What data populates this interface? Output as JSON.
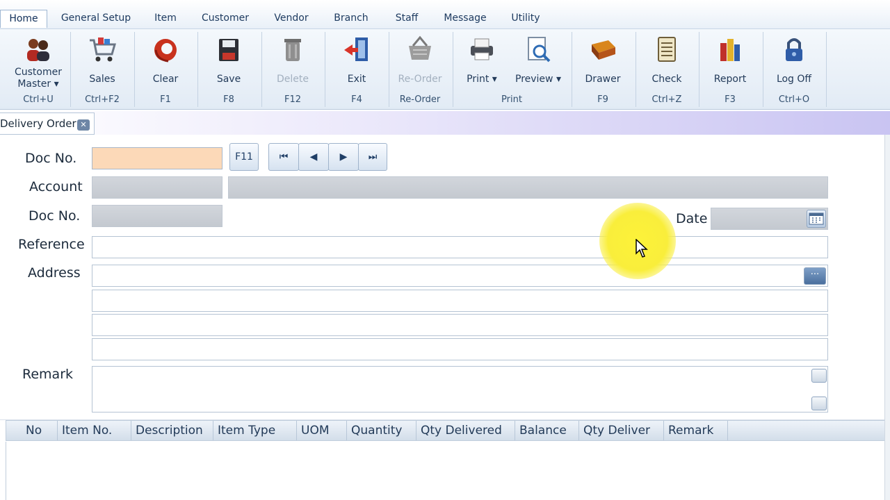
{
  "menu": {
    "tabs": [
      "Home",
      "General Setup",
      "Item",
      "Customer",
      "Vendor",
      "Branch",
      "Staff",
      "Message",
      "Utility"
    ]
  },
  "ribbon": {
    "buttons": [
      {
        "label_line1": "Customer",
        "label_line2": "Master ▾",
        "shortcut": "Ctrl+U",
        "icon": "customers-icon",
        "enabled": true
      },
      {
        "label": "Sales",
        "shortcut": "Ctrl+F2",
        "icon": "shopping-cart-icon",
        "enabled": true
      },
      {
        "label": "Clear",
        "shortcut": "F1",
        "icon": "clear-icon",
        "enabled": true
      },
      {
        "label": "Save",
        "shortcut": "F8",
        "icon": "floppy-disk-icon",
        "enabled": true
      },
      {
        "label": "Delete",
        "shortcut": "F12",
        "icon": "trash-can-icon",
        "enabled": false
      },
      {
        "label": "Exit",
        "shortcut": "F4",
        "icon": "exit-door-icon",
        "enabled": true
      },
      {
        "label": "Re-Order",
        "shortcut": "Re-Order",
        "icon": "basket-icon",
        "enabled": false
      },
      {
        "label": "Print ▾",
        "icon": "printer-icon",
        "enabled": true
      },
      {
        "label": "Preview ▾",
        "icon": "magnifier-document-icon",
        "enabled": true
      },
      {
        "label": "Drawer",
        "shortcut": "F9",
        "icon": "cash-drawer-icon",
        "enabled": true
      },
      {
        "label": "Check",
        "shortcut": "Ctrl+Z",
        "icon": "checklist-icon",
        "enabled": true
      },
      {
        "label": "Report",
        "shortcut": "F3",
        "icon": "report-books-icon",
        "enabled": true
      },
      {
        "label": "Log Off",
        "shortcut": "Ctrl+O",
        "icon": "padlock-icon",
        "enabled": true
      }
    ],
    "print_group_label": "Print"
  },
  "doc_tab": {
    "title": "Delivery Order"
  },
  "form": {
    "doc_no_label": "Doc No.",
    "f11_label": "F11",
    "nav": {
      "first": "⏮",
      "prev": "◀",
      "next": "▶",
      "last": "⏭"
    },
    "account_label": "Account",
    "doc_no2_label": "Doc No.",
    "date_label": "Date",
    "reference_label": "Reference",
    "address_label": "Address",
    "remark_label": "Remark",
    "address_button": "···"
  },
  "grid": {
    "columns": [
      "No",
      "Item No.",
      "Description",
      "Item Type",
      "UOM",
      "Quantity",
      "Qty Delivered",
      "Balance",
      "Qty Deliver",
      "Remark"
    ]
  },
  "colors": {
    "accent": "#1e3b60",
    "doc_no_field": "#fcd9b8",
    "cursor_highlight": "#fdf23a"
  }
}
